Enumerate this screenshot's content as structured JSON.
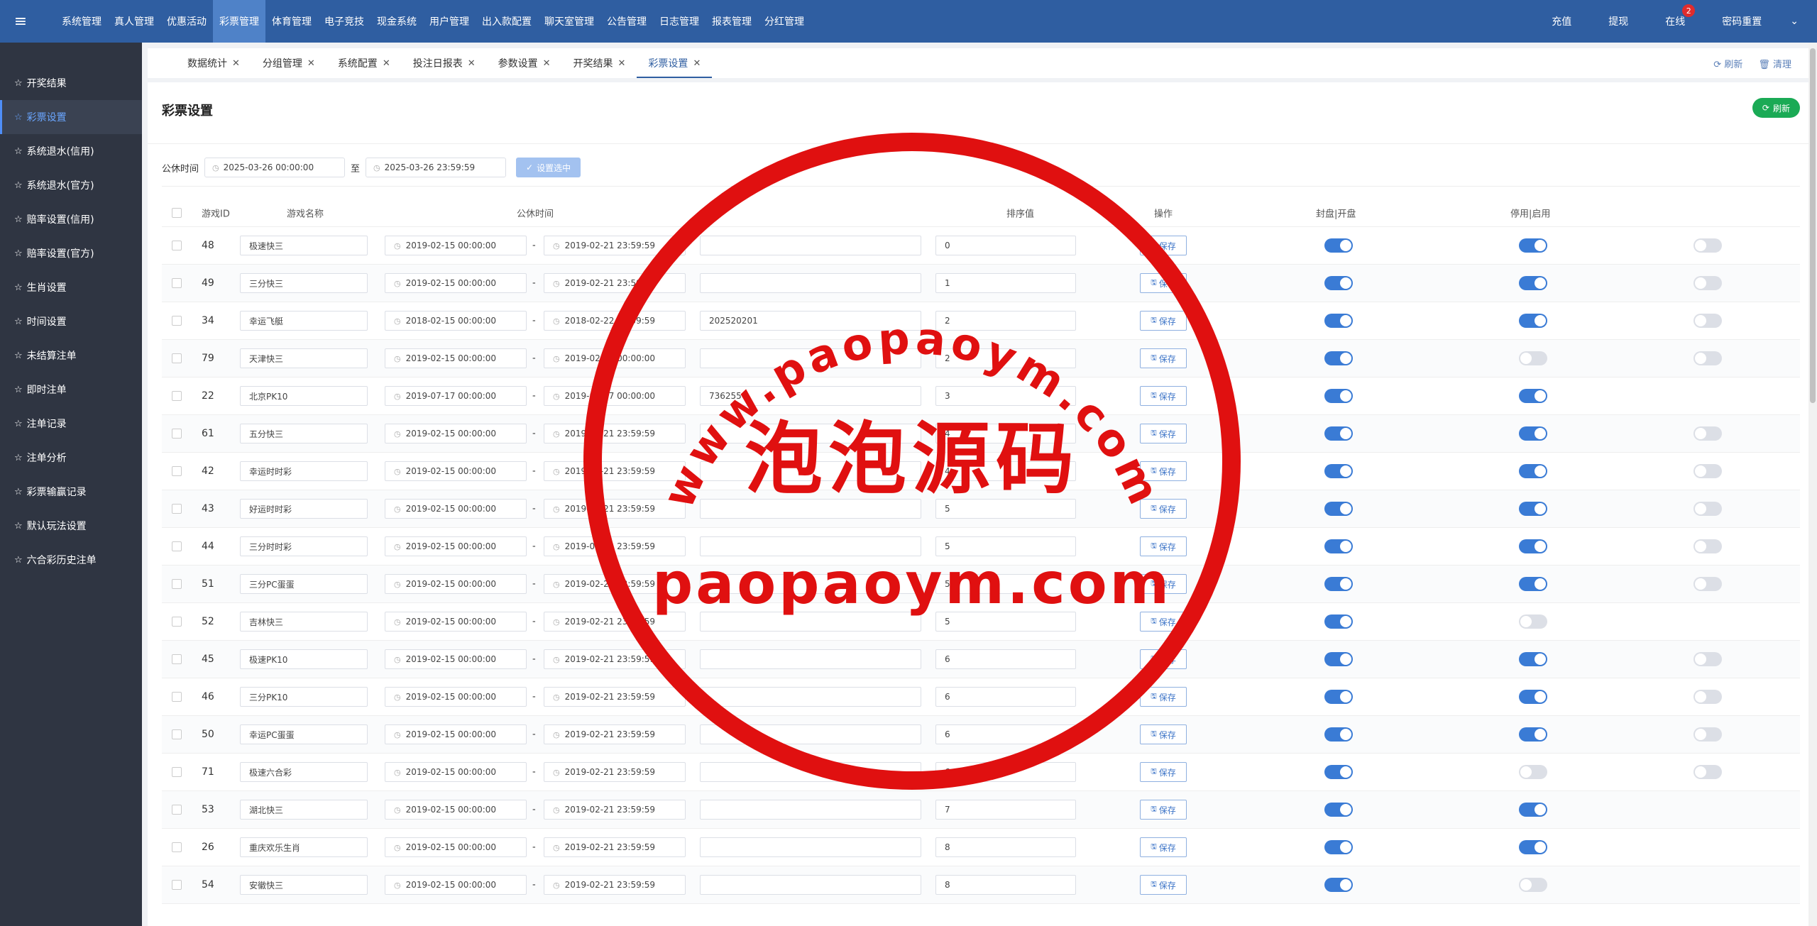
{
  "topnav": {
    "items": [
      "系统管理",
      "真人管理",
      "优惠活动",
      "彩票管理",
      "体育管理",
      "电子竞技",
      "现金系统",
      "用户管理",
      "出入款配置",
      "聊天室管理",
      "公告管理",
      "日志管理",
      "报表管理",
      "分红管理"
    ],
    "active_index": 3,
    "right": {
      "recharge": "充值",
      "withdraw": "提现",
      "online": "在线",
      "online_count": "2",
      "password_reset": "密码重置"
    }
  },
  "sidebar": {
    "items": [
      "开奖结果",
      "彩票设置",
      "系统退水(信用)",
      "系统退水(官方)",
      "赔率设置(信用)",
      "赔率设置(官方)",
      "生肖设置",
      "时间设置",
      "未结算注单",
      "即时注单",
      "注单记录",
      "注单分析",
      "彩票输赢记录",
      "默认玩法设置",
      "六合彩历史注单"
    ],
    "active_index": 1
  },
  "tabs": {
    "items": [
      "数据统计",
      "分组管理",
      "系统配置",
      "投注日报表",
      "参数设置",
      "开奖结果",
      "彩票设置"
    ],
    "active_index": 6,
    "refresh": "刷新",
    "clear": "清理"
  },
  "page": {
    "title": "彩票设置",
    "refresh_button": "刷新"
  },
  "filter": {
    "label": "公休时间",
    "start": "2025-03-26 00:00:00",
    "to": "至",
    "end": "2025-03-26 23:59:59",
    "set_button": "设置选中"
  },
  "table": {
    "headers": {
      "id": "游戏ID",
      "name": "游戏名称",
      "rest_time": "公休时间",
      "sort": "排序值",
      "action": "操作",
      "close_open": "封盘|开盘",
      "disable_enable": "停用|启用"
    },
    "save_label": "保存",
    "rows": [
      {
        "id": "48",
        "name": "极速快三",
        "start": "2019-02-15 00:00:00",
        "end": "2019-02-21 23:59:59",
        "issue": "",
        "sort": "0",
        "s1": true,
        "s2": true,
        "s3": false
      },
      {
        "id": "49",
        "name": "三分快三",
        "start": "2019-02-15 00:00:00",
        "end": "2019-02-21 23:59:59",
        "issue": "",
        "sort": "1",
        "s1": true,
        "s2": true,
        "s3": false
      },
      {
        "id": "34",
        "name": "幸运飞艇",
        "start": "2018-02-15 00:00:00",
        "end": "2018-02-22 23:59:59",
        "issue": "202520201",
        "sort": "2",
        "s1": true,
        "s2": true,
        "s3": false
      },
      {
        "id": "79",
        "name": "天津快三",
        "start": "2019-02-15 00:00:00",
        "end": "2019-02-21 00:00:00",
        "issue": "",
        "sort": "2",
        "s1": true,
        "s2": false,
        "s3": false
      },
      {
        "id": "22",
        "name": "北京PK10",
        "start": "2019-07-17 00:00:00",
        "end": "2019-07-17 00:00:00",
        "issue": "736255",
        "sort": "3",
        "s1": true,
        "s2": true,
        "s3": null
      },
      {
        "id": "61",
        "name": "五分快三",
        "start": "2019-02-15 00:00:00",
        "end": "2019-02-21 23:59:59",
        "issue": "",
        "sort": "4",
        "s1": true,
        "s2": true,
        "s3": false
      },
      {
        "id": "42",
        "name": "幸运时时彩",
        "start": "2019-02-15 00:00:00",
        "end": "2019-02-21 23:59:59",
        "issue": "",
        "sort": "4",
        "s1": true,
        "s2": true,
        "s3": false
      },
      {
        "id": "43",
        "name": "好运时时彩",
        "start": "2019-02-15 00:00:00",
        "end": "2019-02-21 23:59:59",
        "issue": "",
        "sort": "5",
        "s1": true,
        "s2": true,
        "s3": false
      },
      {
        "id": "44",
        "name": "三分时时彩",
        "start": "2019-02-15 00:00:00",
        "end": "2019-02-21 23:59:59",
        "issue": "",
        "sort": "5",
        "s1": true,
        "s2": true,
        "s3": false
      },
      {
        "id": "51",
        "name": "三分PC蛋蛋",
        "start": "2019-02-15 00:00:00",
        "end": "2019-02-21 23:59:59",
        "issue": "",
        "sort": "5",
        "s1": true,
        "s2": true,
        "s3": false
      },
      {
        "id": "52",
        "name": "吉林快三",
        "start": "2019-02-15 00:00:00",
        "end": "2019-02-21 23:59:59",
        "issue": "",
        "sort": "5",
        "s1": true,
        "s2": false,
        "s3": null
      },
      {
        "id": "45",
        "name": "极速PK10",
        "start": "2019-02-15 00:00:00",
        "end": "2019-02-21 23:59:59",
        "issue": "",
        "sort": "6",
        "s1": true,
        "s2": true,
        "s3": false
      },
      {
        "id": "46",
        "name": "三分PK10",
        "start": "2019-02-15 00:00:00",
        "end": "2019-02-21 23:59:59",
        "issue": "",
        "sort": "6",
        "s1": true,
        "s2": true,
        "s3": false
      },
      {
        "id": "50",
        "name": "幸运PC蛋蛋",
        "start": "2019-02-15 00:00:00",
        "end": "2019-02-21 23:59:59",
        "issue": "",
        "sort": "6",
        "s1": true,
        "s2": true,
        "s3": false
      },
      {
        "id": "71",
        "name": "极速六合彩",
        "start": "2019-02-15 00:00:00",
        "end": "2019-02-21 23:59:59",
        "issue": "",
        "sort": "6",
        "s1": true,
        "s2": false,
        "s3": false
      },
      {
        "id": "53",
        "name": "湖北快三",
        "start": "2019-02-15 00:00:00",
        "end": "2019-02-21 23:59:59",
        "issue": "",
        "sort": "7",
        "s1": true,
        "s2": true,
        "s3": null
      },
      {
        "id": "26",
        "name": "重庆欢乐生肖",
        "start": "2019-02-15 00:00:00",
        "end": "2019-02-21 23:59:59",
        "issue": "",
        "sort": "8",
        "s1": true,
        "s2": true,
        "s3": null
      },
      {
        "id": "54",
        "name": "安徽快三",
        "start": "2019-02-15 00:00:00",
        "end": "2019-02-21 23:59:59",
        "issue": "",
        "sort": "8",
        "s1": true,
        "s2": false,
        "s3": null
      }
    ]
  },
  "watermark": {
    "url": "www.paopaoym.com",
    "name": "泡泡源码",
    "domain": "paopaoym.com"
  },
  "colors": {
    "topbar": "#2f5ea1",
    "sidebar": "#2f3542",
    "accent": "#3a7bd5",
    "success": "#1aaa55",
    "stamp": "#e01010"
  }
}
